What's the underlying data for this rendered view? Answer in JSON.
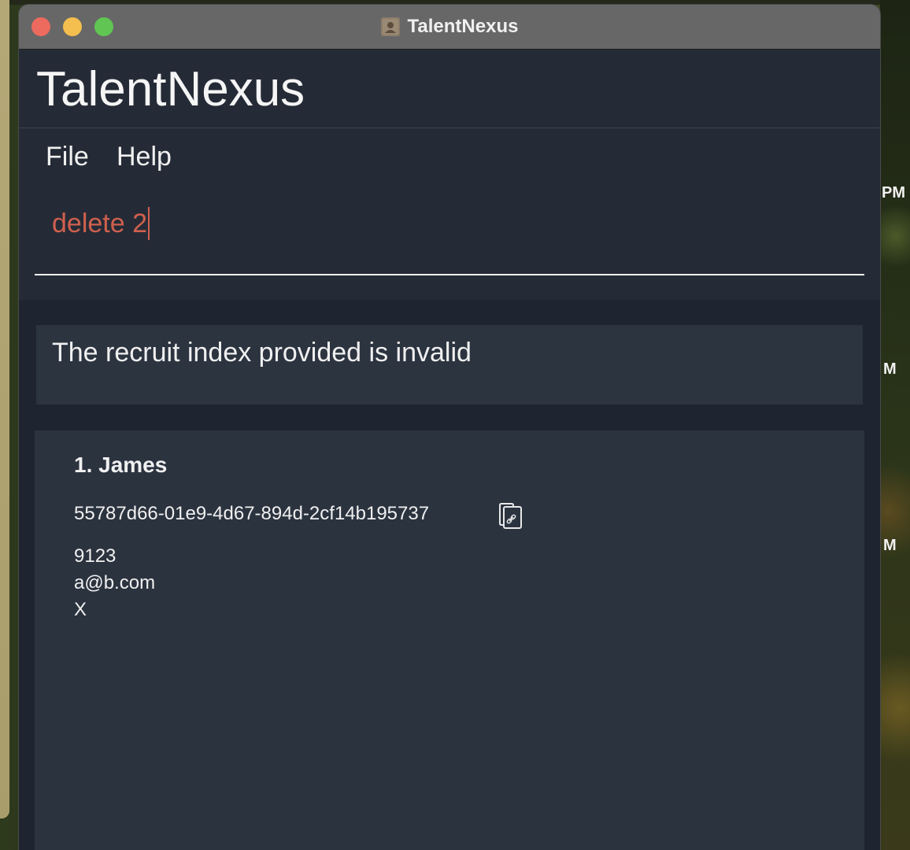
{
  "desktop": {
    "clock_fragments": [
      "PM",
      "M",
      "M"
    ]
  },
  "window": {
    "title": "TalentNexus",
    "icon": "contacts-icon"
  },
  "app": {
    "title": "TalentNexus"
  },
  "menu": {
    "file_label": "File",
    "help_label": "Help"
  },
  "command": {
    "value": "delete 2",
    "color": "#d0604e"
  },
  "result": {
    "message": "The recruit index provided is invalid"
  },
  "recruits": [
    {
      "index_name": "1.  James",
      "id": "55787d66-01e9-4d67-894d-2cf14b195737",
      "phone": "9123",
      "email": "a@b.com",
      "address": "X"
    }
  ]
}
